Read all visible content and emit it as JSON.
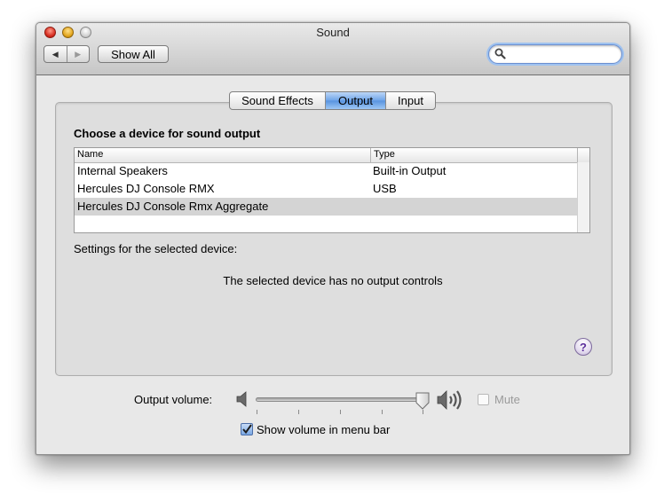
{
  "window": {
    "title": "Sound"
  },
  "toolbar": {
    "back_glyph": "◀",
    "forward_glyph": "▶",
    "show_all_label": "Show All",
    "search_value": "",
    "search_placeholder": ""
  },
  "tabs": [
    {
      "label": "Sound Effects",
      "active": false
    },
    {
      "label": "Output",
      "active": true
    },
    {
      "label": "Input",
      "active": false
    }
  ],
  "output": {
    "heading": "Choose a device for sound output",
    "columns": [
      "Name",
      "Type"
    ],
    "devices": [
      {
        "name": "Internal Speakers",
        "type": "Built-in Output",
        "selected": false
      },
      {
        "name": "Hercules DJ Console RMX",
        "type": "USB",
        "selected": false
      },
      {
        "name": "Hercules DJ Console Rmx Aggregate",
        "type": "",
        "selected": true
      }
    ],
    "settings_label": "Settings for the selected device:",
    "no_controls_message": "The selected device has no output controls",
    "help_glyph": "?"
  },
  "volume": {
    "label": "Output volume:",
    "level": 0.98,
    "muted": false,
    "mute_enabled": false,
    "mute_label": "Mute",
    "show_in_menu_bar": true,
    "show_in_menu_bar_label": "Show volume in menu bar"
  },
  "colors": {
    "accent": "#5893df",
    "selection_row": "#d4d4d4",
    "help_purple": "#5b2d9b"
  }
}
